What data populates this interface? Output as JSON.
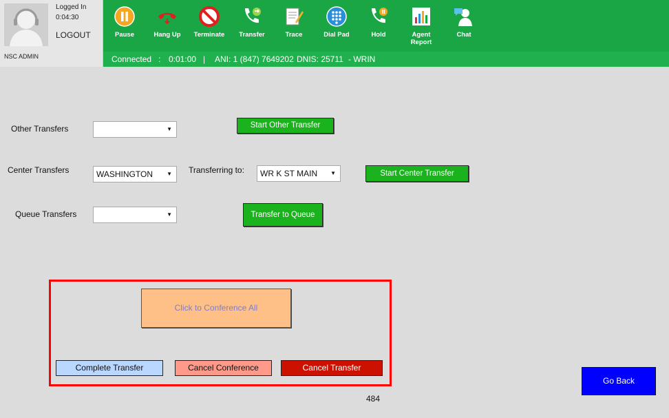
{
  "header": {
    "logged_in_label": "Logged In",
    "logged_in_time": "0:04:30",
    "logout_label": "LOGOUT",
    "username": "NSC ADMIN"
  },
  "toolbar": {
    "pause": "Pause",
    "hang_up": "Hang Up",
    "terminate": "Terminate",
    "transfer": "Transfer",
    "trace": "Trace",
    "dial_pad": "Dial Pad",
    "hold": "Hold",
    "agent_report_1": "Agent",
    "agent_report_2": "Report",
    "chat": "Chat"
  },
  "status": {
    "state": "Connected",
    "sep1": ":",
    "duration": "0:01:00",
    "sep2": "|",
    "ani": "ANI: 1 (847) 7649202",
    "dnis": "DNIS: 25711",
    "wrin": "- WRIN"
  },
  "transfers": {
    "other_label": "Other Transfers",
    "other_value": "",
    "other_button": "Start Other Transfer",
    "center_label": "Center Transfers",
    "center_value": "WASHINGTON",
    "transferring_to_label": "Transferring to:",
    "transferring_to_value": "WR K ST MAIN",
    "center_button": "Start Center Transfer",
    "queue_label": "Queue Transfers",
    "queue_value": "",
    "queue_button": "Transfer to Queue"
  },
  "conference": {
    "conference_all": "Click to Conference All",
    "complete_transfer": "Complete Transfer",
    "cancel_conference": "Cancel Conference",
    "cancel_transfer": "Cancel Transfer"
  },
  "footer": {
    "go_back": "Go Back",
    "page_number": "484"
  },
  "colors": {
    "header_green": "#1aa645",
    "button_green": "#1bb31d",
    "conference_orange": "#ffc088",
    "complete_blue": "#b9d7ff",
    "cancel_conf_pink": "#ff9a8a",
    "cancel_transfer_red": "#cc1100",
    "go_back_blue": "#0000ff",
    "highlight_red": "#ff0000"
  }
}
